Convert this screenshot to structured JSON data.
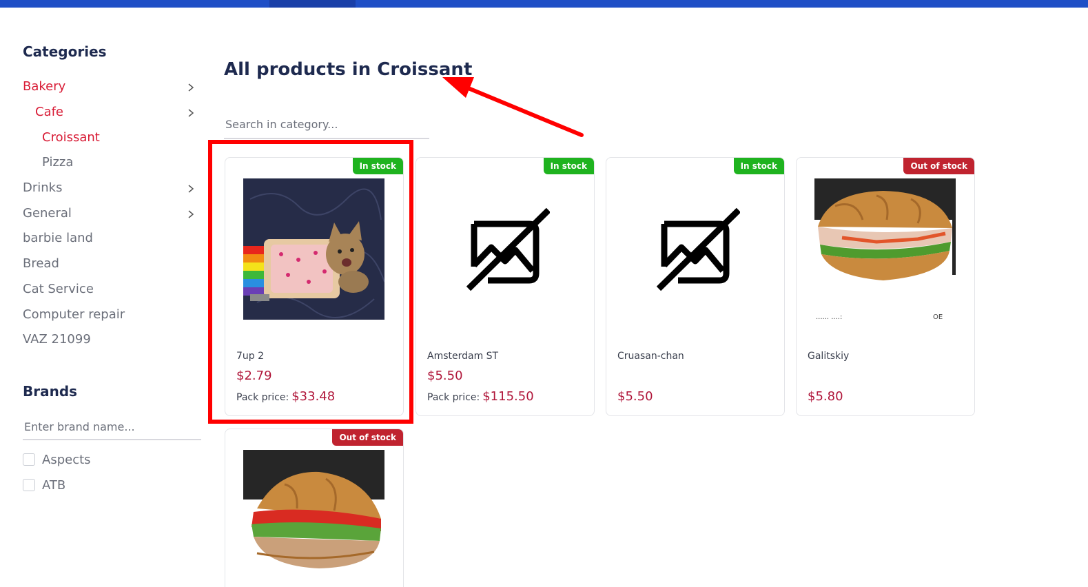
{
  "sidebar": {
    "categories_heading": "Categories",
    "categories": [
      {
        "label": "Bakery",
        "active": true
      },
      {
        "label": "Cafe",
        "active": true
      },
      {
        "label": "Croissant",
        "active": true
      },
      {
        "label": "Pizza",
        "active": false
      },
      {
        "label": "Drinks",
        "active": false
      },
      {
        "label": "General",
        "active": false
      },
      {
        "label": "barbie land",
        "active": false
      },
      {
        "label": "Bread",
        "active": false
      },
      {
        "label": "Cat Service",
        "active": false
      },
      {
        "label": "Computer repair",
        "active": false
      },
      {
        "label": "VAZ 21099",
        "active": false
      }
    ],
    "brands_heading": "Brands",
    "brand_search_placeholder": "Enter brand name...",
    "brands": [
      {
        "label": "Aspects",
        "checked": false
      },
      {
        "label": "ATB",
        "checked": false
      }
    ]
  },
  "main": {
    "title": "All products in Croissant",
    "search_placeholder": "Search in category...",
    "pack_price_label": "Pack price:",
    "products": [
      {
        "name": "7up 2",
        "price": "$2.79",
        "pack_price": "$33.48",
        "stock": "In stock",
        "image": "nyan-cat-image"
      },
      {
        "name": "Amsterdam ST",
        "price": "$5.50",
        "pack_price": "$115.50",
        "stock": "In stock",
        "image": "no-image-icon"
      },
      {
        "name": "Cruasan-chan",
        "price": "$5.50",
        "stock": "In stock",
        "image": "no-image-icon"
      },
      {
        "name": "Galitskiy",
        "price": "$5.80",
        "stock": "Out of stock",
        "image": "croissant-sandwich-image"
      },
      {
        "stock": "Out of stock",
        "image": "croissant-sandwich-image"
      }
    ]
  },
  "colors": {
    "accent_red": "#d81b35",
    "price_red": "#b0163a",
    "in_stock_green": "#1fb31f",
    "out_of_stock_red": "#c0232f",
    "topbar_blue": "#1f4fc6",
    "annotation_red": "#ff0000"
  }
}
